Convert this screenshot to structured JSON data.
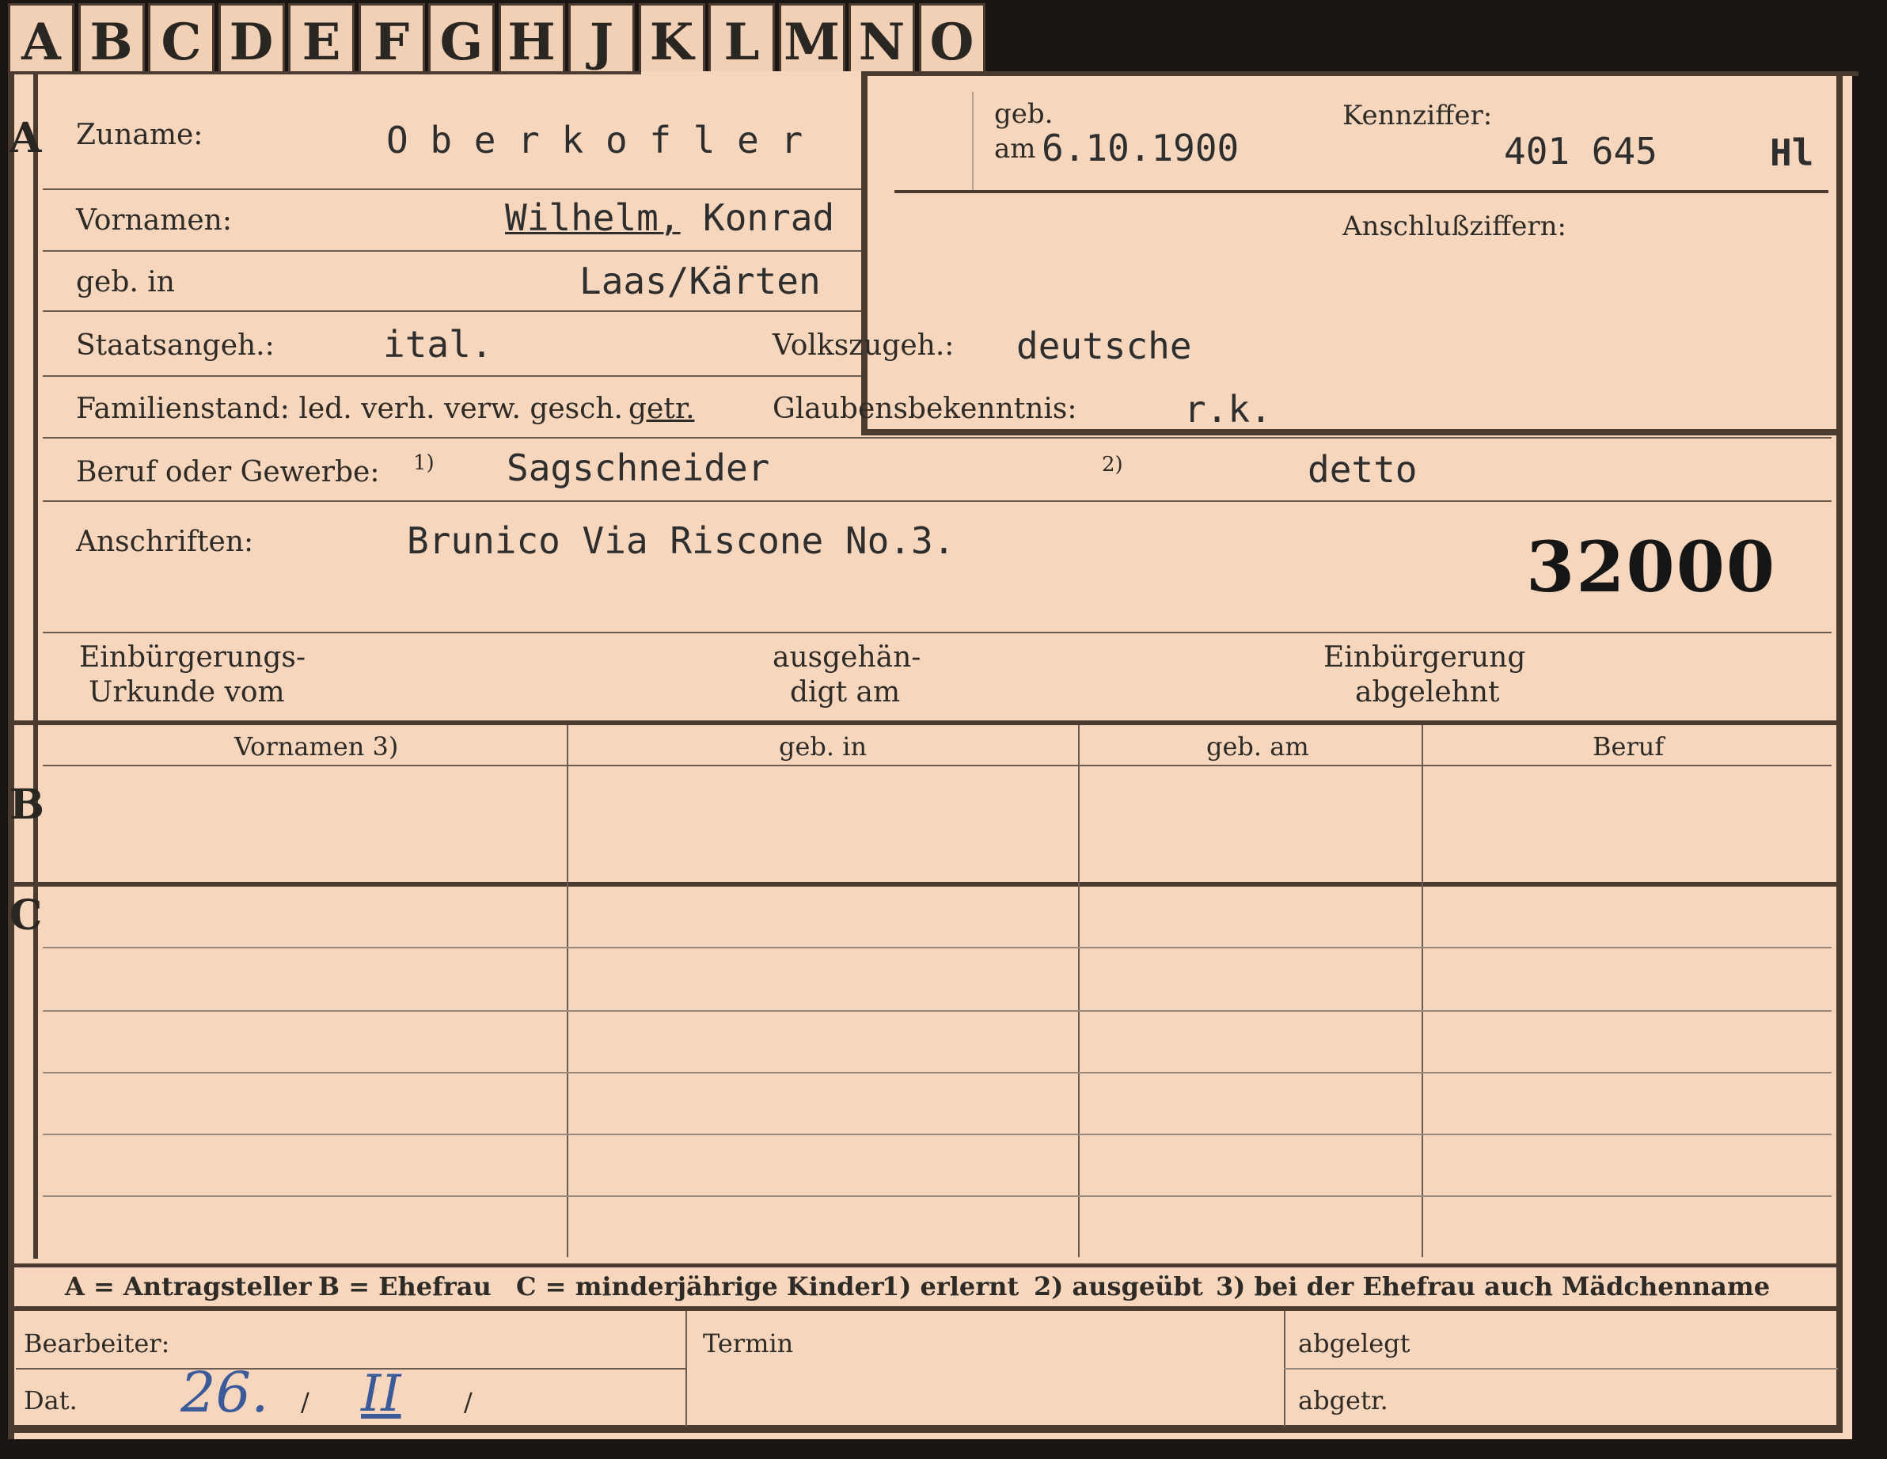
{
  "tabs": [
    "A",
    "B",
    "C",
    "D",
    "E",
    "F",
    "G",
    "H",
    "J",
    "K",
    "L",
    "M",
    "N",
    "O"
  ],
  "sections": {
    "a": "A",
    "b": "B",
    "c": "C"
  },
  "fields": {
    "zuname_label": "Zuname:",
    "zuname_value": "O b e r k o f l e r",
    "geb_label": "geb.",
    "am_label": "am",
    "geb_am_value": "6.10.1900",
    "kennziffer_label": "Kennziffer:",
    "kennziffer_value": "401 645",
    "kennziffer_code": "Hl",
    "anschluss_label": "Anschlußziffern:",
    "vornamen_label": "Vornamen:",
    "vornamen_value_1": "Wilhelm,",
    "vornamen_value_2": "Konrad",
    "geb_in_label": "geb. in",
    "geb_in_value": "Laas/Kärten",
    "staatsangeh_label": "Staatsangeh.:",
    "staatsangeh_value": "ital.",
    "volkszugeh_label": "Volkszugeh.:",
    "volkszugeh_value": "deutsche",
    "familienstand_label": "Familienstand: led. verh. verw. gesch.",
    "familienstand_selected": "getr.",
    "glaubens_label": "Glaubensbekenntnis:",
    "glaubens_value": "r.k.",
    "beruf_label": "Beruf oder Gewerbe:",
    "note1": "1)",
    "beruf_value_1": "Sagschneider",
    "note2": "2)",
    "beruf_value_2": "detto",
    "anschriften_label": "Anschriften:",
    "anschriften_value": "Brunico Via Riscone No.3.",
    "stamp_number": "32000",
    "einb_urkunde_1": "Einbürgerungs-",
    "einb_urkunde_2": "Urkunde vom",
    "ausgeh_1": "ausgehän-",
    "ausgeh_2": "digt am",
    "einb_abgelehnt_1": "Einbürgerung",
    "einb_abgelehnt_2": "abgelehnt"
  },
  "table": {
    "headers": [
      "Vornamen 3)",
      "geb. in",
      "geb. am",
      "Beruf"
    ]
  },
  "legend": {
    "a": "A = Antragsteller",
    "b": "B = Ehefrau",
    "c": "C = minderjährige Kinder",
    "n1": "1) erlernt",
    "n2": "2) ausgeübt",
    "n3": "3) bei der Ehefrau auch Mädchenname"
  },
  "footer": {
    "bearbeiter_label": "Bearbeiter:",
    "dat_label": "Dat.",
    "dat_day": "26.",
    "dat_sep1": "/",
    "dat_month": "II",
    "dat_sep2": "/",
    "termin_label": "Termin",
    "abgelegt_label": "abgelegt",
    "abgetr_label": "abgetr."
  },
  "colors": {
    "card": "#f6d6bc",
    "ink": "#2e2a26",
    "rule": "#4a3a30",
    "handwriting": "#3a5a9a"
  }
}
